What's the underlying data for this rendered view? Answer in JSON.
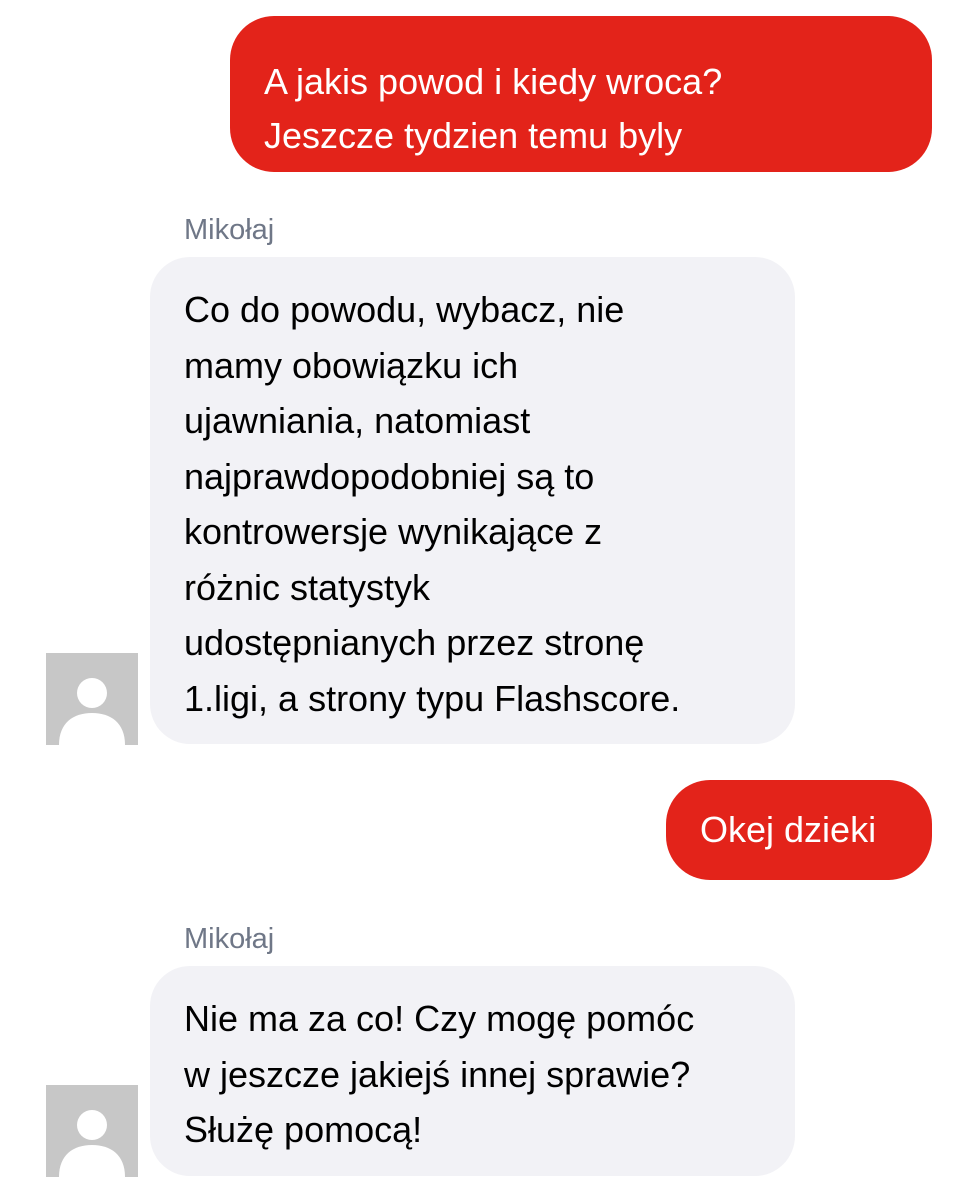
{
  "messages": [
    {
      "direction": "outgoing",
      "text": "A jakis powod i kiedy wroca?\nJeszcze tydzien temu byly"
    },
    {
      "direction": "incoming",
      "sender": "Mikołaj",
      "text": "Co do powodu, wybacz, nie\nmamy obowiązku ich\nujawniania, natomiast\nnajprawdopodobniej są to\nkontrowersje wynikające z\nróżnic statystyk\nudostępnianych przez stronę\n1.ligi, a strony typu Flashscore."
    },
    {
      "direction": "outgoing",
      "text": "Okej dzieki"
    },
    {
      "direction": "incoming",
      "sender": "Mikołaj",
      "text": "Nie ma za co! Czy mogę pomóc\nw jeszcze jakiejś innej sprawie?\nSłużę pomocą!"
    }
  ],
  "colors": {
    "outgoing_bubble": "#e3231a",
    "incoming_bubble": "#f2f2f6",
    "sender_name": "#6f7787",
    "avatar_placeholder": "#c7c7c7"
  },
  "icons": {
    "avatar": "default-user-silhouette"
  }
}
